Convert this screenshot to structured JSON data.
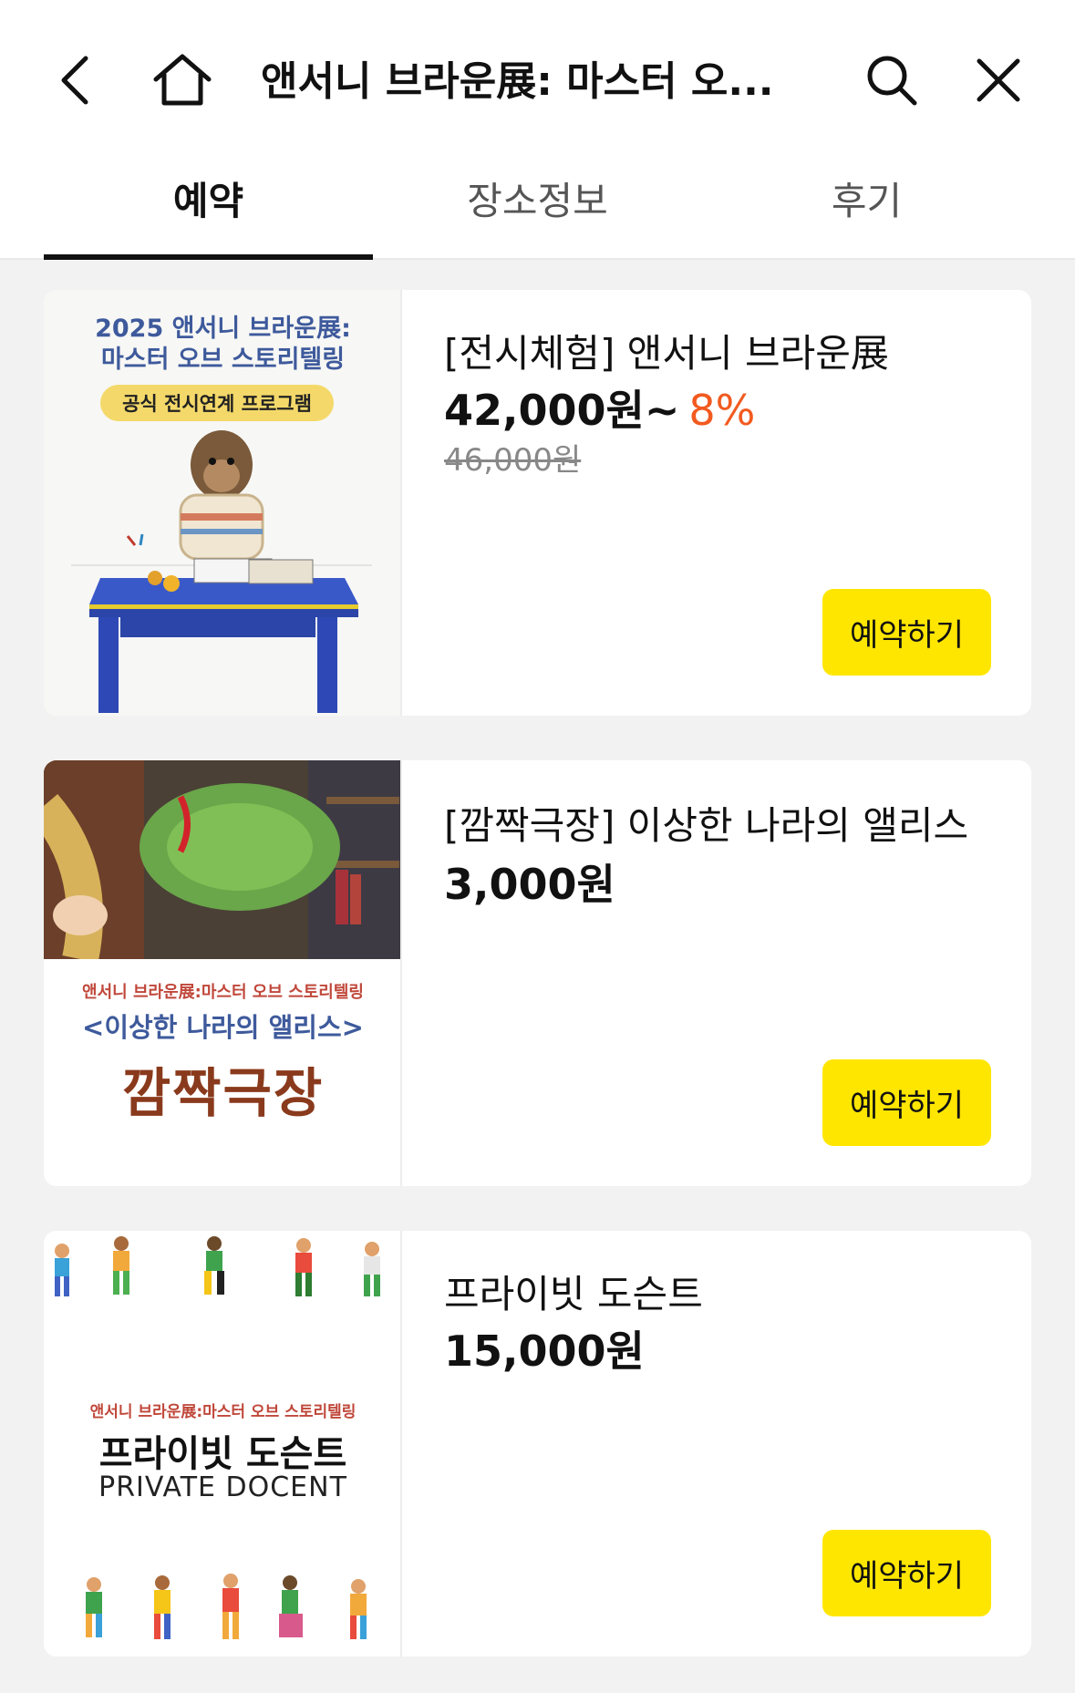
{
  "header": {
    "title": "앤서니 브라운展: 마스터 오...",
    "icons": [
      "chevron-left-icon",
      "home-icon",
      "search-icon",
      "close-icon"
    ]
  },
  "tabs": [
    {
      "label": "예약",
      "active": true
    },
    {
      "label": "장소정보",
      "active": false
    },
    {
      "label": "후기",
      "active": false
    }
  ],
  "products": [
    {
      "title": "[전시체험] 앤서니 브라운展",
      "price": "42,000원~",
      "discount": "8%",
      "original_price": "46,000원",
      "button": "예약하기",
      "thumb": {
        "line1": "2025 앤서니 브라운展:",
        "line2": "마스터 오브 스토리텔링",
        "badge": "공식 전시연계 프로그램"
      }
    },
    {
      "title": "[깜짝극장] 이상한 나라의 앨리스",
      "price": "3,000원",
      "button": "예약하기",
      "thumb": {
        "sub": "앤서니 브라운展:마스터 오브 스토리텔링",
        "alice": "<이상한 나라의 앨리스>",
        "big": "깜짝극장"
      }
    },
    {
      "title": "프라이빗 도슨트",
      "price": "15,000원",
      "button": "예약하기",
      "thumb": {
        "sub": "앤서니 브라운展:마스터 오브 스토리텔링",
        "big": "프라이빗 도슨트",
        "eng": "PRIVATE DOCENT"
      }
    }
  ],
  "colors": {
    "accent_button": "#ffe600",
    "discount": "#f25a1f",
    "background": "#f2f2f2"
  }
}
